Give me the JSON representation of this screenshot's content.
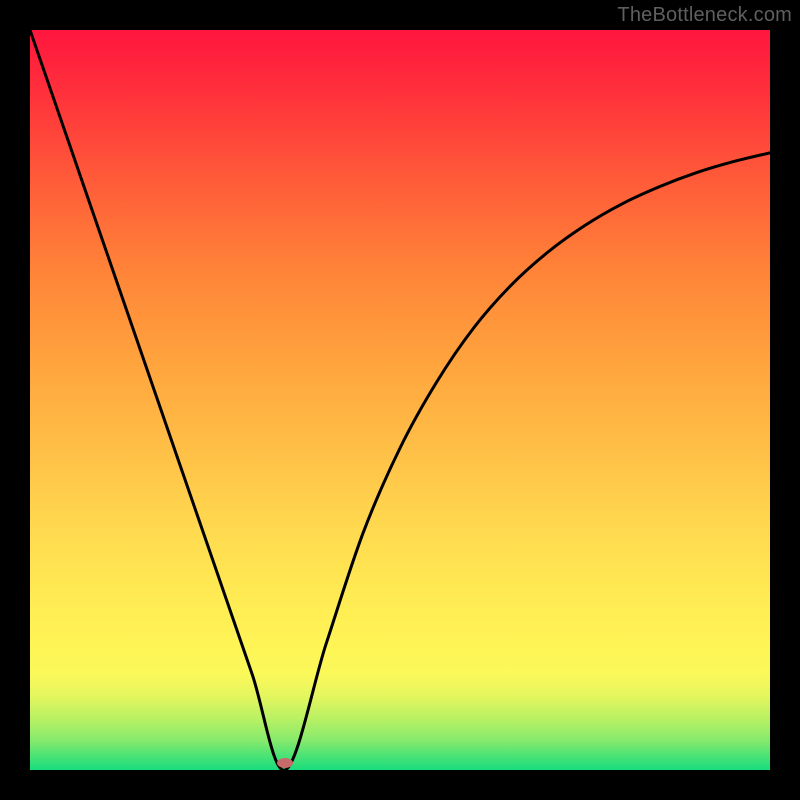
{
  "watermark": "TheBottleneck.com",
  "chart_data": {
    "type": "line",
    "title": "",
    "xlabel": "",
    "ylabel": "",
    "xlim": [
      0,
      100
    ],
    "ylim": [
      0,
      100
    ],
    "grid": false,
    "x": [
      0,
      5,
      10,
      15,
      20,
      25,
      30,
      34.5,
      40,
      45,
      50,
      55,
      60,
      65,
      70,
      75,
      80,
      85,
      90,
      95,
      100
    ],
    "values": [
      100,
      85.5,
      71,
      56.5,
      42,
      27.5,
      13,
      0,
      17,
      32,
      43.5,
      52.5,
      59.8,
      65.5,
      70,
      73.6,
      76.5,
      78.8,
      80.7,
      82.2,
      83.4
    ],
    "vertex_x": 34.5,
    "marker": {
      "x": 34.5,
      "y": 1.0,
      "color": "#c76a6a"
    },
    "background_gradient": {
      "direction": "vertical",
      "stops": [
        {
          "pos": 0.0,
          "color": "#ff163e"
        },
        {
          "pos": 0.45,
          "color": "#ffa43d"
        },
        {
          "pos": 0.83,
          "color": "#fff456"
        },
        {
          "pos": 1.0,
          "color": "#18dd7d"
        }
      ]
    },
    "line_color": "#000000",
    "line_width": 3
  }
}
